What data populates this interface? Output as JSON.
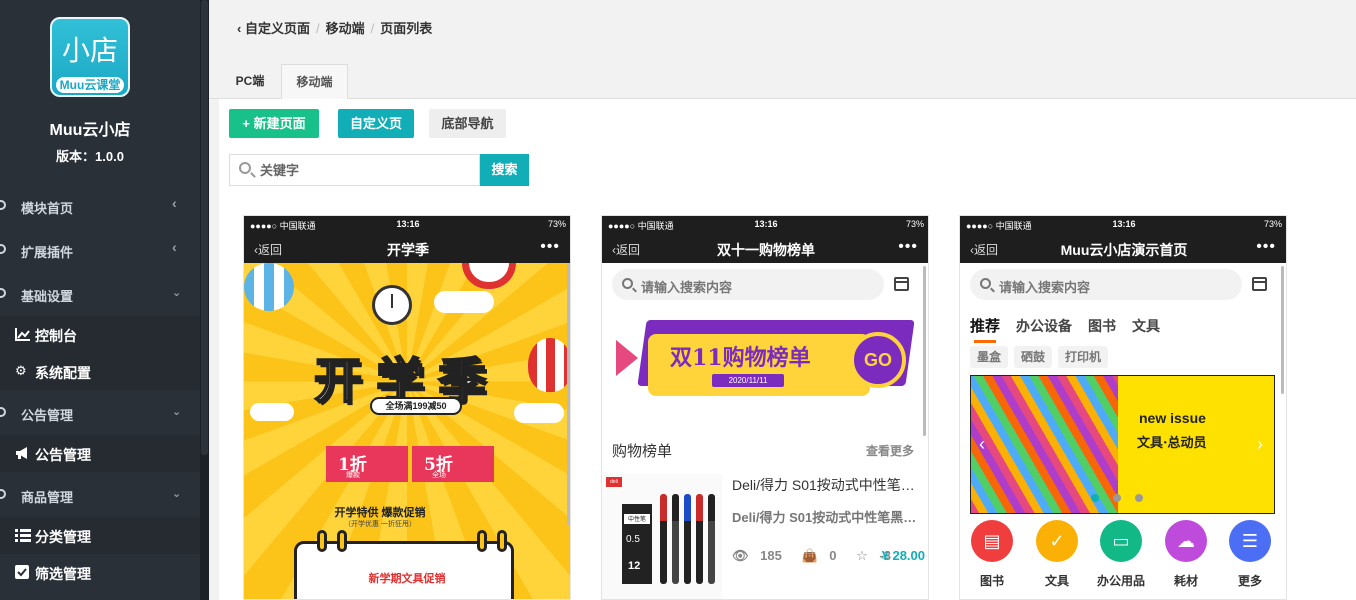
{
  "sidebar": {
    "logo_main": "小店",
    "logo_sub": "Muu云课堂",
    "shop_name": "Muu云小店",
    "version": "版本：1.0.0",
    "groups": [
      {
        "label": "模块首页"
      },
      {
        "label": "扩展插件"
      },
      {
        "label": "基础设置"
      },
      {
        "label": "公告管理"
      },
      {
        "label": "商品管理"
      }
    ],
    "items": [
      {
        "label": "控制台",
        "icon": "chart-icon"
      },
      {
        "label": "系统配置",
        "icon": "gears-icon"
      },
      {
        "label": "公告管理",
        "icon": "megaphone-icon"
      },
      {
        "label": "分类管理",
        "icon": "list-icon"
      },
      {
        "label": "筛选管理",
        "icon": "checkbox-icon"
      }
    ]
  },
  "breadcrumb": [
    "自定义页面",
    "移动端",
    "页面列表"
  ],
  "tabs": {
    "pc": "PC端",
    "mobile": "移动端"
  },
  "toolbar": {
    "new_page": "+ 新建页面",
    "custom_page": "自定义页",
    "bottom_nav": "底部导航"
  },
  "search": {
    "placeholder": "关键字",
    "button": "搜索"
  },
  "phones": [
    {
      "status_left": "●●●●○ 中国联通",
      "status_time": "13:16",
      "status_right": "73%",
      "back": "返回",
      "title": "开学季",
      "more": "•••",
      "poster": {
        "headline": "开学季",
        "pill": "全场满199减50",
        "coupon1": "1折",
        "coupon1_sub": "爆款",
        "coupon2": "5折",
        "coupon2_sub": "全场",
        "text1": "开学特供 爆款促销",
        "text2": "（开学优惠 一折狂甩）",
        "promo": "新学期文具促销"
      }
    },
    {
      "status_left": "●●●●○ 中国联通",
      "status_time": "13:16",
      "status_right": "73%",
      "back": "返回",
      "title": "双十一购物榜单",
      "more": "•••",
      "search_placeholder": "请输入搜索内容",
      "banner_title": "双11购物榜单",
      "banner_date": "2020/11/11",
      "banner_go": "GO",
      "rank_head": "购物榜单",
      "rank_more": "查看更多",
      "product": {
        "title": "Deli/得力 S01按动式中性笔…",
        "subtitle": "Deli/得力 S01按动式中性笔黑…",
        "views": "185",
        "sales": "0",
        "stars": "-3",
        "price": "¥ 28.00",
        "brand": "deli",
        "box_label": "中性笔",
        "box_size": "0.5",
        "box_count": "12"
      }
    },
    {
      "status_left": "●●●●○ 中国联通",
      "status_time": "13:16",
      "status_right": "73%",
      "back": "返回",
      "title": "Muu云小店演示首页",
      "more": "•••",
      "search_placeholder": "请输入搜索内容",
      "cat_tabs": [
        "推荐",
        "办公设备",
        "图书",
        "文具"
      ],
      "tags": [
        "墨盒",
        "硒鼓",
        "打印机"
      ],
      "carousel": {
        "new_issue": "new issue",
        "subtitle": "文具·总动员"
      },
      "icons": [
        {
          "label": "图书",
          "color": "#f03e3e"
        },
        {
          "label": "文具",
          "color": "#fab005"
        },
        {
          "label": "办公用品",
          "color": "#12b886"
        },
        {
          "label": "耗材",
          "color": "#be4bdb"
        },
        {
          "label": "更多",
          "color": "#4c6ef5"
        }
      ]
    }
  ]
}
